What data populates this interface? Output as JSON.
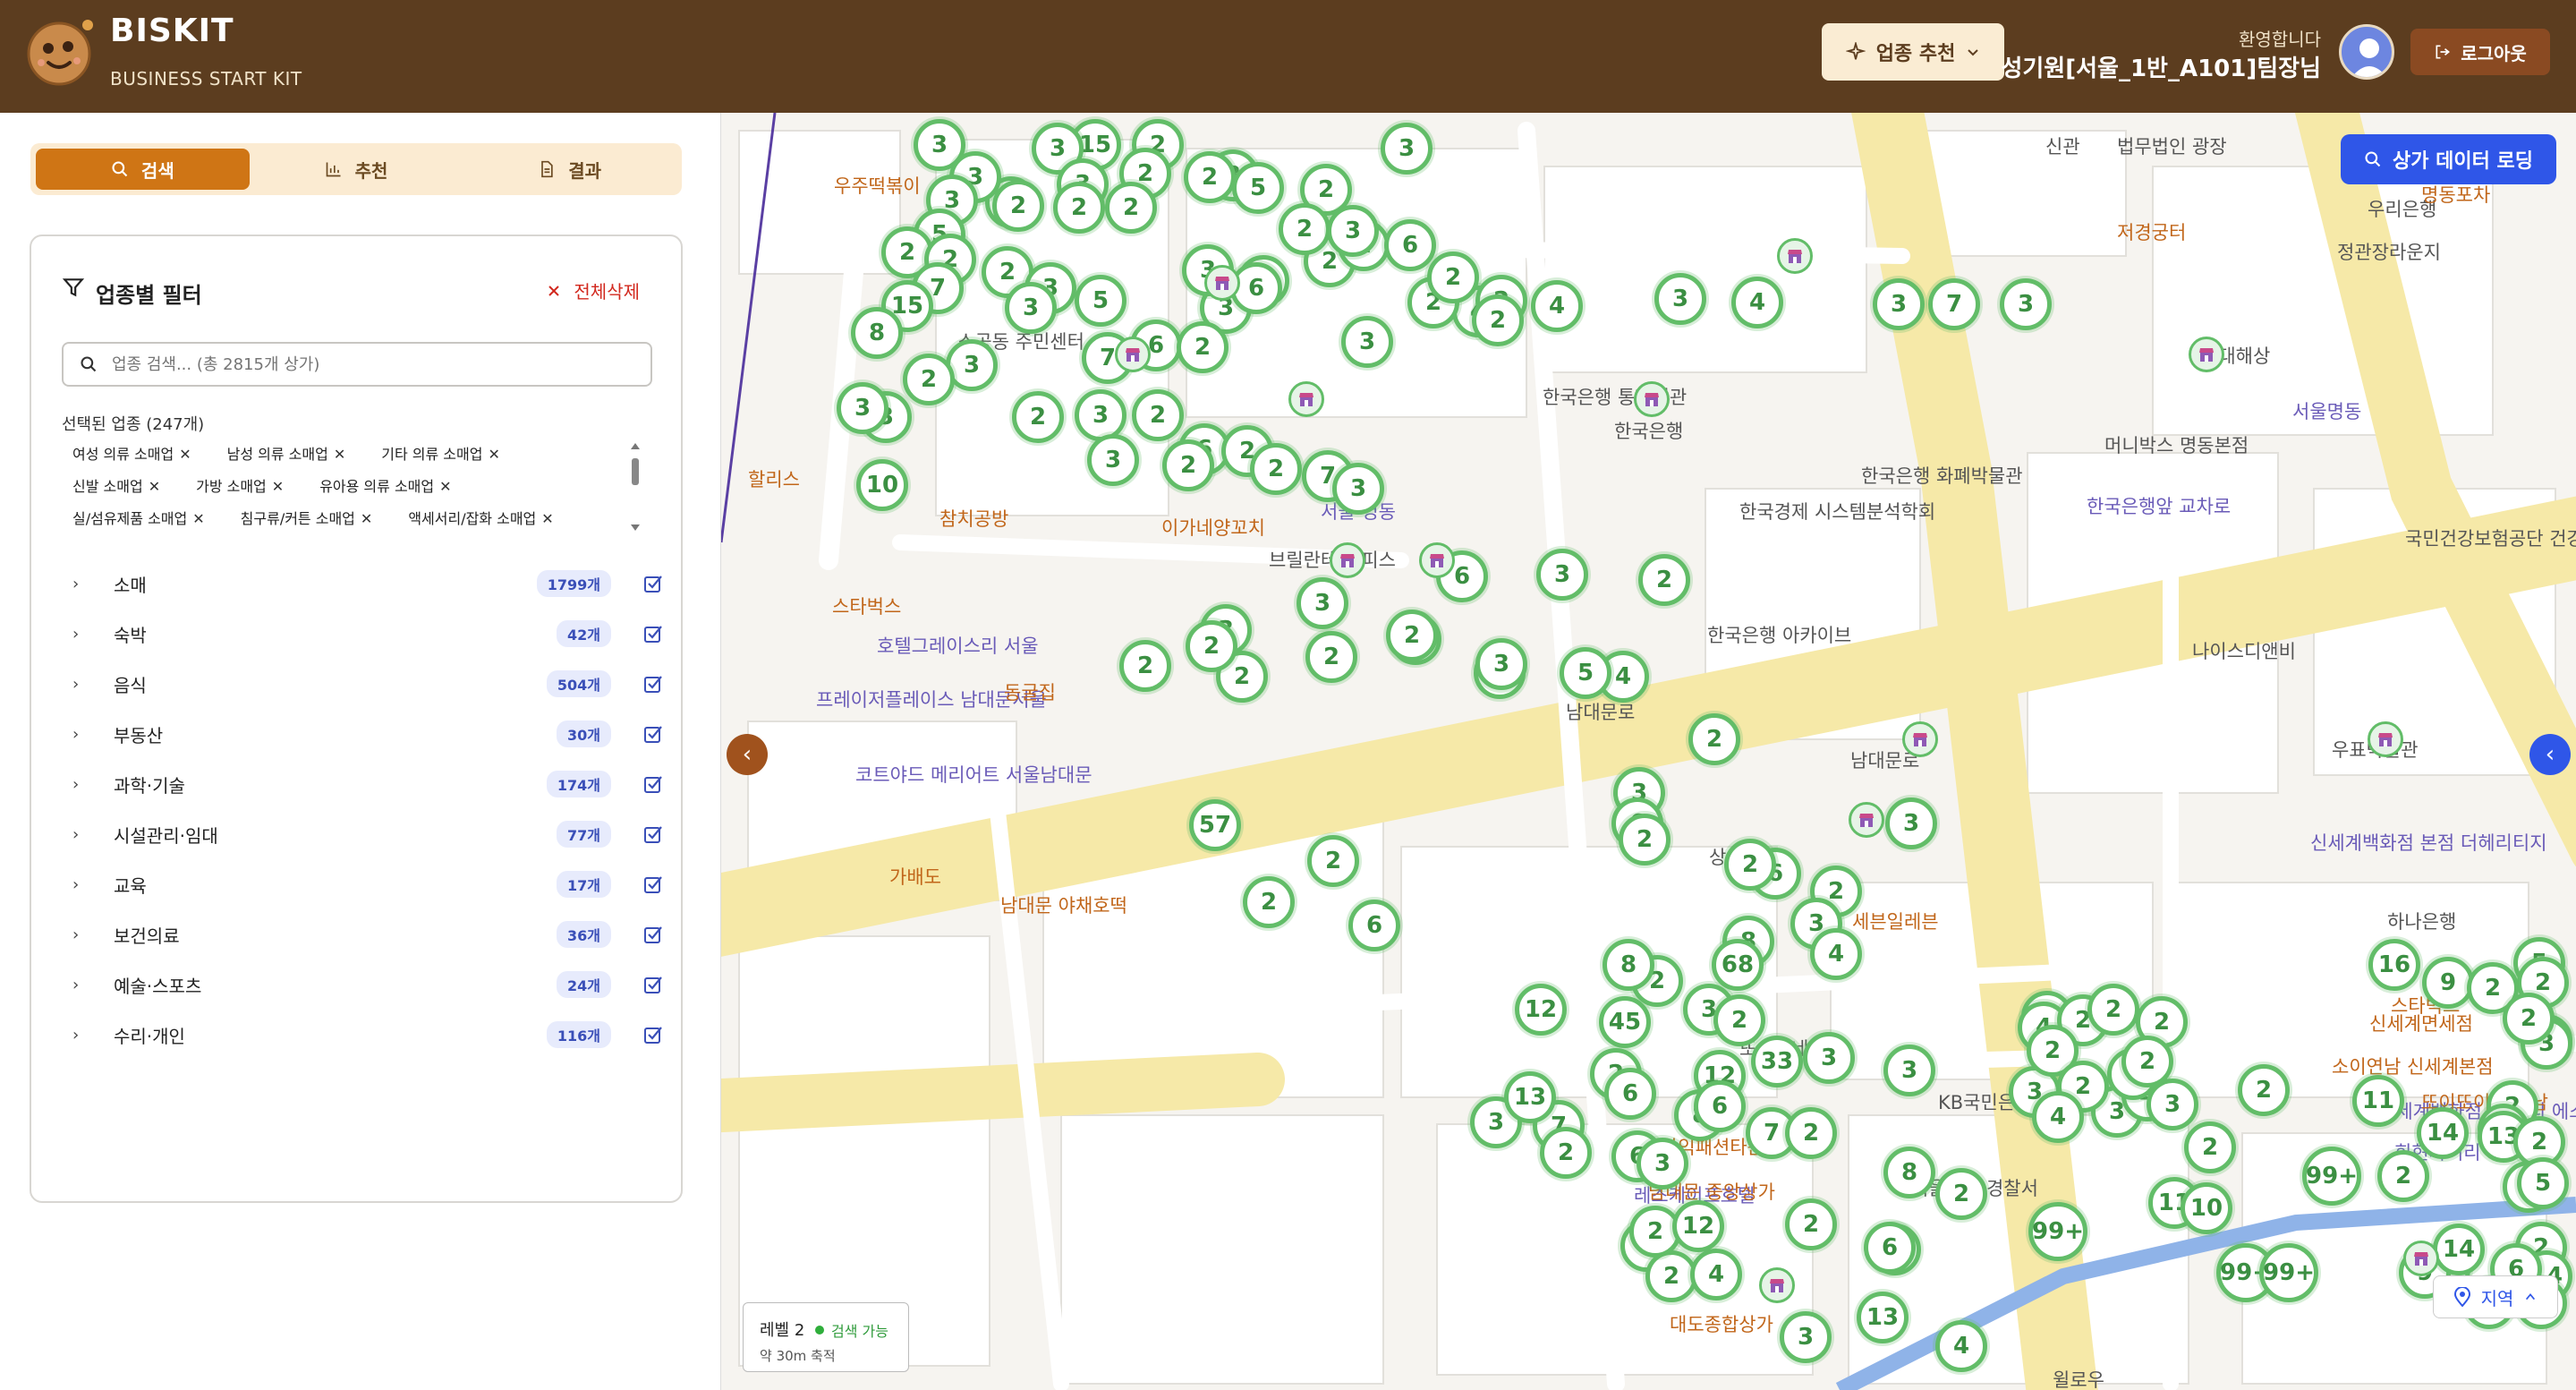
{
  "header": {
    "brand": "BISKIT",
    "subtitle": "BUSINESS START KIT",
    "recommend_button": "업종 추천",
    "welcome": "환영합니다",
    "username": "성기원[서울_1반_A101]팀장님",
    "logout": "로그아웃"
  },
  "sidebar": {
    "tabs": [
      {
        "label": "검색",
        "icon": "search-icon",
        "active": true
      },
      {
        "label": "추천",
        "icon": "bar-chart-icon",
        "active": false
      },
      {
        "label": "결과",
        "icon": "document-icon",
        "active": false
      }
    ],
    "filter": {
      "title": "업종별 필터",
      "clear_all": "전체삭제",
      "search_placeholder": "업종 검색... (총 2815개 상가)",
      "selected_label": "선택된 업종 (247개)",
      "chips": [
        [
          "여성 의류 소매업",
          "남성 의류 소매업",
          "기타 의류 소매업"
        ],
        [
          "신발 소매업",
          "가방 소매업",
          "유아용 의류 소매업"
        ],
        [
          "실/섬유제품 소매업",
          "침구류/커튼 소매업",
          "액세서리/잡화 소매업"
        ]
      ],
      "categories": [
        {
          "name": "소매",
          "count": "1799개"
        },
        {
          "name": "숙박",
          "count": "42개"
        },
        {
          "name": "음식",
          "count": "504개"
        },
        {
          "name": "부동산",
          "count": "30개"
        },
        {
          "name": "과학·기술",
          "count": "174개"
        },
        {
          "name": "시설관리·임대",
          "count": "77개"
        },
        {
          "name": "교육",
          "count": "17개"
        },
        {
          "name": "보건의료",
          "count": "36개"
        },
        {
          "name": "예술·스포츠",
          "count": "24개"
        },
        {
          "name": "수리·개인",
          "count": "116개"
        }
      ]
    }
  },
  "map": {
    "load_button": "상가 데이터 로딩",
    "level": "레벨 2",
    "level_status": "검색 가능",
    "level_scale": "약 30m 축적",
    "region_button": "지역",
    "labels": [
      {
        "text": "신관",
        "c": "g"
      },
      {
        "text": "법무법인 광장",
        "c": "g"
      },
      {
        "text": "저경궁터",
        "c": "o"
      },
      {
        "text": "한국은행 통합별관",
        "c": "g"
      },
      {
        "text": "한국은행",
        "c": "g"
      },
      {
        "text": "한국은행 화폐박물관",
        "c": "g"
      },
      {
        "text": "한국경제 시스템분석학회",
        "c": "g"
      },
      {
        "text": "한국은행앞 교차로",
        "c": "b"
      },
      {
        "text": "국민건강보험공단 건강정보 리서치협력센터",
        "c": "g"
      },
      {
        "text": "한국은행 아카이브",
        "c": "g"
      },
      {
        "text": "나이스디앤비",
        "c": "g"
      },
      {
        "text": "우표박물관",
        "c": "g"
      },
      {
        "text": "하나은행",
        "c": "g"
      },
      {
        "text": "남대문로",
        "c": "g"
      },
      {
        "text": "신세계백화점 본점 더헤리티지",
        "c": "b"
      },
      {
        "text": "신세계면세점",
        "c": "o"
      },
      {
        "text": "스타벅스",
        "c": "o"
      },
      {
        "text": "소이연남 신세계본점",
        "c": "o"
      },
      {
        "text": "신세계백화점 본점 디 에스테이트",
        "c": "b"
      },
      {
        "text": "또이또이 베트남",
        "c": "o"
      },
      {
        "text": "회현사거리",
        "c": "b"
      },
      {
        "text": "세븐일레븐",
        "c": "o"
      },
      {
        "text": "상동교회",
        "c": "g"
      },
      {
        "text": "또순이네",
        "c": "g"
      },
      {
        "text": "삼익패션타운",
        "c": "o"
      },
      {
        "text": "레스케이프호텔",
        "c": "b"
      },
      {
        "text": "서울중부 경찰서",
        "c": "g"
      },
      {
        "text": "남대문 중앙상가",
        "c": "o"
      },
      {
        "text": "KB국민은행",
        "c": "g"
      },
      {
        "text": "대도종합상가",
        "c": "o"
      },
      {
        "text": "참치공방",
        "c": "o"
      },
      {
        "text": "소공동 주민센터",
        "c": "g"
      },
      {
        "text": "호텔그레이스리 서울",
        "c": "b"
      },
      {
        "text": "프레이저플레이스 남대문서울",
        "c": "b"
      },
      {
        "text": "코트야드 메리어트 서울남대문",
        "c": "b"
      },
      {
        "text": "가배도",
        "c": "o"
      },
      {
        "text": "남대문 야채호떡",
        "c": "o"
      },
      {
        "text": "남대문로",
        "c": "g"
      },
      {
        "text": "윌로우",
        "c": "g"
      },
      {
        "text": "현대해상",
        "c": "g"
      },
      {
        "text": "머니박스 명동본점",
        "c": "g"
      },
      {
        "text": "정관장라운지",
        "c": "g"
      },
      {
        "text": "서울명동",
        "c": "b"
      },
      {
        "text": "우리은행",
        "c": "g"
      },
      {
        "text": "명동포차",
        "c": "o"
      },
      {
        "text": "이가네양꼬치",
        "c": "o"
      },
      {
        "text": "브릴란테 오피스",
        "c": "g"
      },
      {
        "text": "서울 명동",
        "c": "b"
      },
      {
        "text": "동굴집",
        "c": "o"
      },
      {
        "text": "우주떡볶이",
        "c": "o"
      },
      {
        "text": "할리스",
        "c": "o"
      },
      {
        "text": "스타벅스",
        "c": "o"
      }
    ],
    "clusters": [
      "3",
      "15",
      "2",
      "3",
      "3",
      "2",
      "3",
      "3",
      "2",
      "3",
      "2",
      "2",
      "5",
      "2",
      "3",
      "5",
      "2",
      "2",
      "2",
      "3",
      "2",
      "2",
      "7",
      "3",
      "5",
      "3",
      "7",
      "2",
      "2",
      "15",
      "8",
      "7",
      "6",
      "2",
      "3",
      "6",
      "2",
      "3",
      "6",
      "3",
      "4",
      "2",
      "2",
      "2",
      "2",
      "4",
      "3",
      "4",
      "3",
      "3",
      "7",
      "3",
      "3",
      "2",
      "2",
      "3",
      "2",
      "3",
      "10",
      "6",
      "3",
      "2",
      "2",
      "7",
      "2",
      "3",
      "6",
      "3",
      "3",
      "2",
      "3",
      "2",
      "2",
      "2",
      "2",
      "4",
      "3",
      "4",
      "5",
      "2",
      "2",
      "2",
      "57",
      "2",
      "3",
      "6",
      "2",
      "3",
      "6",
      "2",
      "2",
      "3",
      "4",
      "6",
      "2",
      "8",
      "68",
      "2",
      "8",
      "45",
      "3",
      "12",
      "2",
      "2",
      "12",
      "33",
      "3",
      "3",
      "7",
      "8",
      "2",
      "2",
      "3",
      "7",
      "3",
      "6",
      "3",
      "8",
      "6",
      "13",
      "6",
      "2",
      "5",
      "2",
      "2",
      "4",
      "12",
      "3",
      "2",
      "6",
      "4",
      "13",
      "99+",
      "11",
      "99+",
      "10",
      "99+",
      "99+",
      "11",
      "3",
      "2",
      "4",
      "6",
      "13",
      "3",
      "4",
      "2",
      "2",
      "2",
      "2",
      "2",
      "4",
      "3",
      "2",
      "2",
      "2",
      "2",
      "5",
      "3",
      "9",
      "2",
      "16",
      "2",
      "2",
      "2",
      "14",
      "13",
      "2",
      "4",
      "2",
      "2",
      "2",
      "9",
      "14",
      "3",
      "5",
      "14",
      "6",
      "5",
      "3",
      "2",
      "12",
      "3",
      "7",
      "99+",
      "3",
      "2",
      "2"
    ]
  }
}
